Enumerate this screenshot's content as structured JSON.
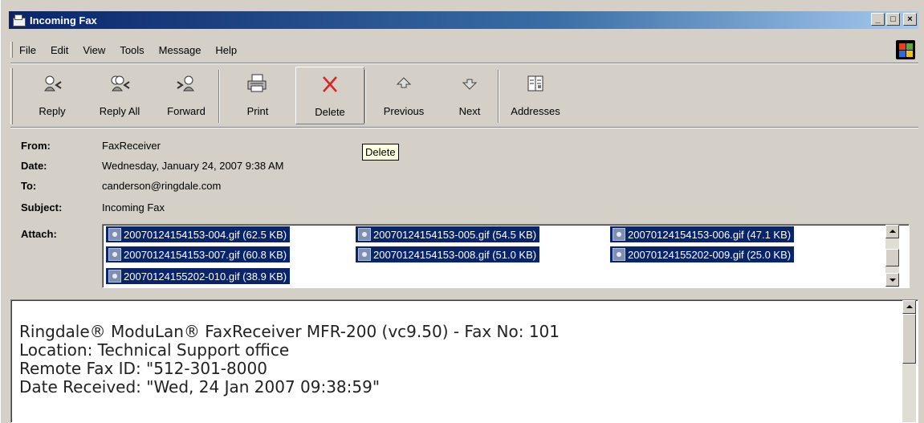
{
  "window": {
    "title": "Incoming Fax"
  },
  "menu": [
    "File",
    "Edit",
    "View",
    "Tools",
    "Message",
    "Help"
  ],
  "toolbar": {
    "reply": "Reply",
    "reply_all": "Reply All",
    "forward": "Forward",
    "print": "Print",
    "delete": "Delete",
    "previous": "Previous",
    "next": "Next",
    "addresses": "Addresses"
  },
  "tooltip": "Delete",
  "header": {
    "from_label": "From:",
    "from": "FaxReceiver",
    "date_label": "Date:",
    "date": "Wednesday, January 24, 2007 9:38 AM",
    "to_label": "To:",
    "to": "canderson@ringdale.com",
    "subject_label": "Subject:",
    "subject": "Incoming Fax",
    "attach_label": "Attach:"
  },
  "attachments": [
    "20070124154153-004.gif (62.5 KB)",
    "20070124154153-005.gif (54.5 KB)",
    "20070124154153-006.gif (47.1 KB)",
    "20070124154153-007.gif (60.8 KB)",
    "20070124154153-008.gif (51.0 KB)",
    "20070124155202-009.gif (25.0 KB)",
    "20070124155202-010.gif (38.9 KB)"
  ],
  "body_lines": [
    "Ringdale® ModuLan® FaxReceiver MFR-200 (vc9.50) - Fax No: 101",
    "Location: Technical Support office",
    "Remote Fax ID: \"512-301-8000",
    "Date Received: \"Wed, 24 Jan 2007 09:38:59\""
  ],
  "colors": {
    "titlebar_start": "#0a246a",
    "selection": "#0a246a",
    "face": "#d4d0c8"
  }
}
